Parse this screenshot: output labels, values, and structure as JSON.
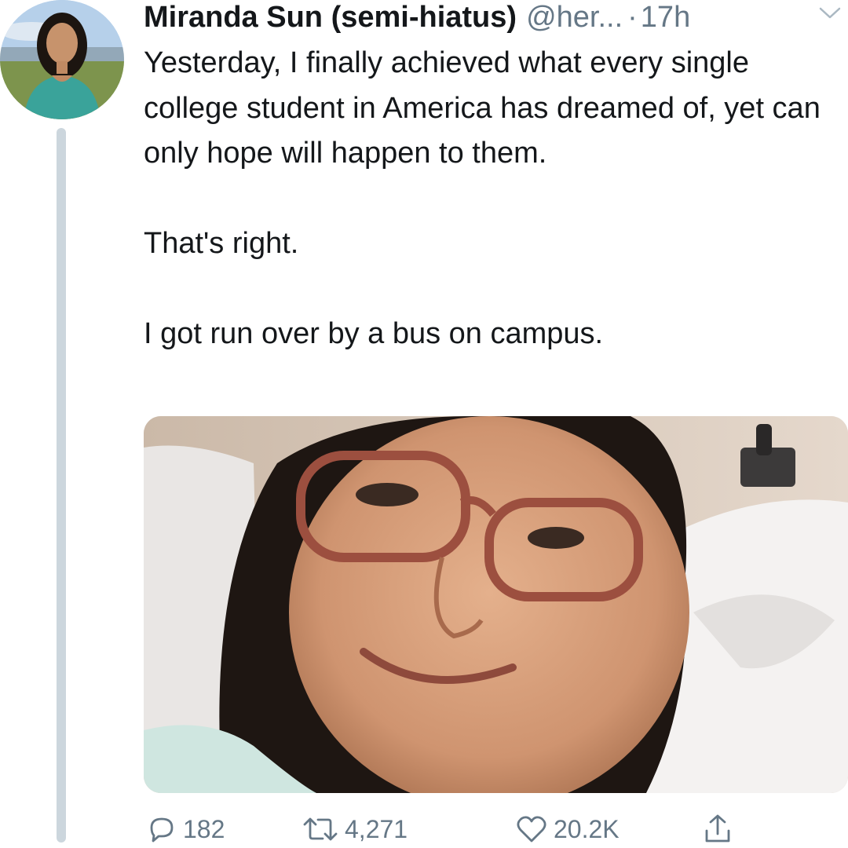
{
  "tweet": {
    "author": {
      "display_name": "Miranda Sun (semi-hiatus)",
      "handle": "@her...",
      "separator": "·",
      "time_ago": "17h"
    },
    "text": {
      "paragraph_1": "Yesterday, I finally achieved what every single college student in America has dreamed of, yet can only hope will happen to them.",
      "paragraph_2": "That's right.",
      "paragraph_3": "I got run over by a bus on campus."
    },
    "actions": {
      "reply_count": "182",
      "retweet_count": "4,271",
      "like_count": "20.2K"
    },
    "icons": {
      "reply": "reply-icon",
      "retweet": "retweet-icon",
      "like": "heart-icon",
      "share": "share-icon",
      "menu": "chevron-down-icon"
    },
    "colors": {
      "text": "#14171a",
      "secondary": "#657786",
      "thread_line": "#ccd6dd"
    }
  }
}
